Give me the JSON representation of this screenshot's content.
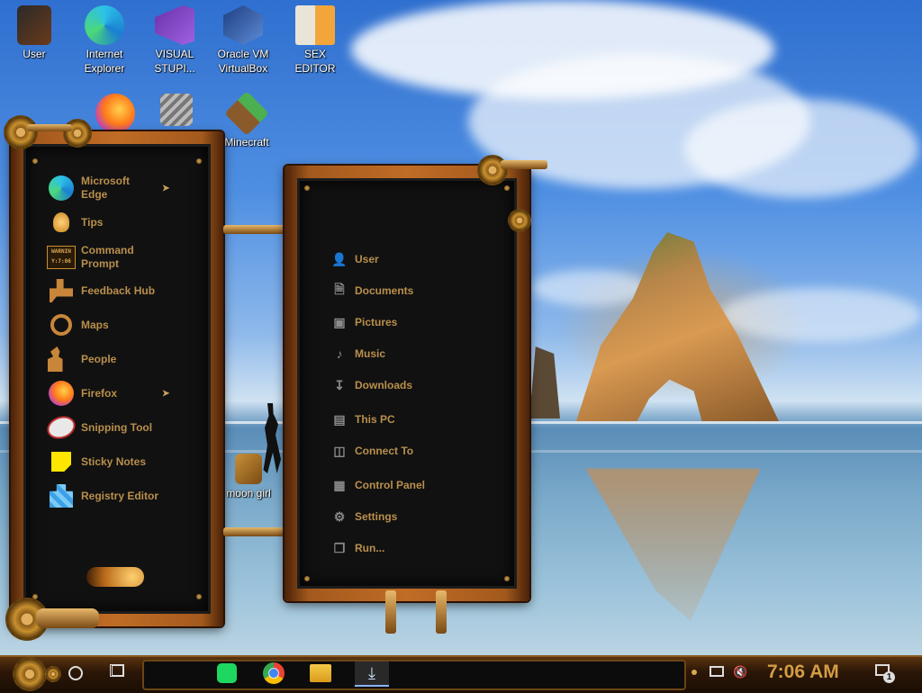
{
  "desktop": {
    "icons": [
      {
        "label": "User"
      },
      {
        "label": "Internet Explorer"
      },
      {
        "label": "VISUAL STUPI..."
      },
      {
        "label": "Oracle VM VirtualBox"
      },
      {
        "label": "SEX EDITOR"
      },
      {
        "label": "Minecraft"
      },
      {
        "label": "moon girl"
      }
    ]
  },
  "start_menu": {
    "apps": [
      {
        "label": "Microsoft Edge",
        "icon": "edge-icon",
        "has_submenu": true
      },
      {
        "label": "Tips",
        "icon": "lightbulb-icon",
        "has_submenu": false
      },
      {
        "label": "Command Prompt",
        "icon": "terminal-icon",
        "has_submenu": false
      },
      {
        "label": "Feedback Hub",
        "icon": "feedback-icon",
        "has_submenu": false
      },
      {
        "label": "Maps",
        "icon": "map-pin-icon",
        "has_submenu": false
      },
      {
        "label": "People",
        "icon": "people-icon",
        "has_submenu": false
      },
      {
        "label": "Firefox",
        "icon": "firefox-icon",
        "has_submenu": true
      },
      {
        "label": "Snipping Tool",
        "icon": "scissors-icon",
        "has_submenu": false
      },
      {
        "label": "Sticky Notes",
        "icon": "sticky-note-icon",
        "has_submenu": false
      },
      {
        "label": "Registry Editor",
        "icon": "registry-icon",
        "has_submenu": false
      }
    ],
    "submenu_arrow": "➤",
    "cmd_icon_text": {
      "line1": "WARNIN",
      "line2": "Y:7:06"
    }
  },
  "places": [
    {
      "label": "User",
      "icon": "user-icon"
    },
    {
      "label": "Documents",
      "icon": "document-icon"
    },
    {
      "label": "Pictures",
      "icon": "picture-icon"
    },
    {
      "label": "Music",
      "icon": "music-note-icon"
    },
    {
      "label": "Downloads",
      "icon": "download-icon"
    },
    {
      "label": "This PC",
      "icon": "monitor-icon"
    },
    {
      "label": "Connect To",
      "icon": "network-icon"
    },
    {
      "label": "Control Panel",
      "icon": "control-panel-icon"
    },
    {
      "label": "Settings",
      "icon": "gear-icon"
    },
    {
      "label": "Run...",
      "icon": "run-icon"
    }
  ],
  "taskbar": {
    "pinned": [
      {
        "name": "spotify-icon"
      },
      {
        "name": "chrome-icon"
      },
      {
        "name": "file-explorer-icon"
      },
      {
        "name": "downloads-icon"
      }
    ],
    "clock": "7:06 AM",
    "notification_count": "1"
  },
  "colors": {
    "menu_text": "#b98f4c",
    "copper": "#c06c25",
    "clock": "#d39d45"
  }
}
